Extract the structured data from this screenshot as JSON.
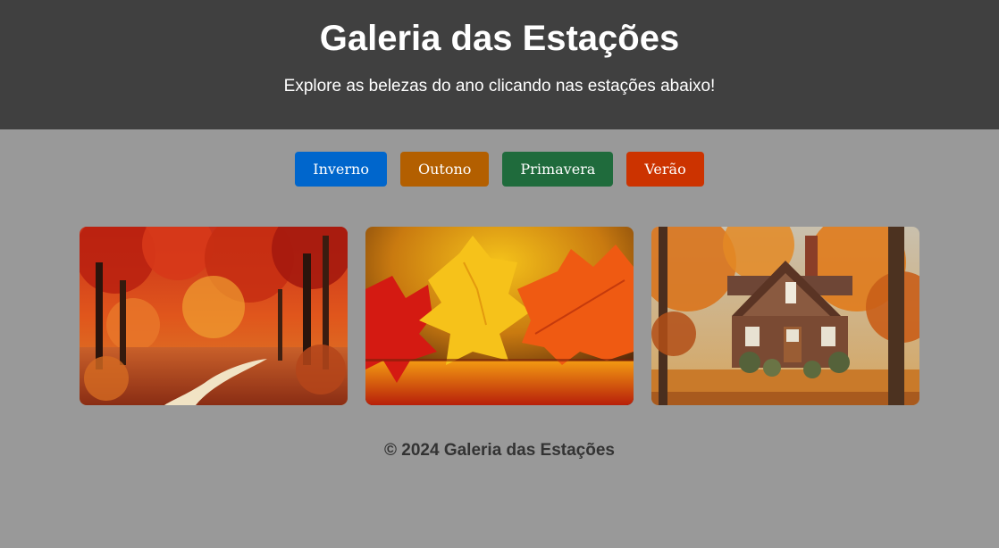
{
  "header": {
    "title": "Galeria das Estações",
    "subtitle": "Explore as belezas do ano clicando nas estações abaixo!"
  },
  "seasons": [
    {
      "label": "Inverno",
      "color": "#0066cc"
    },
    {
      "label": "Outono",
      "color": "#b35f00"
    },
    {
      "label": "Primavera",
      "color": "#1f6b3c"
    },
    {
      "label": "Verão",
      "color": "#cc3300"
    }
  ],
  "gallery": {
    "images": [
      {
        "subject": "autumn-forest-path"
      },
      {
        "subject": "autumn-maple-leaves"
      },
      {
        "subject": "autumn-cabin"
      }
    ]
  },
  "footer": {
    "text": "© 2024 Galeria das Estações"
  }
}
